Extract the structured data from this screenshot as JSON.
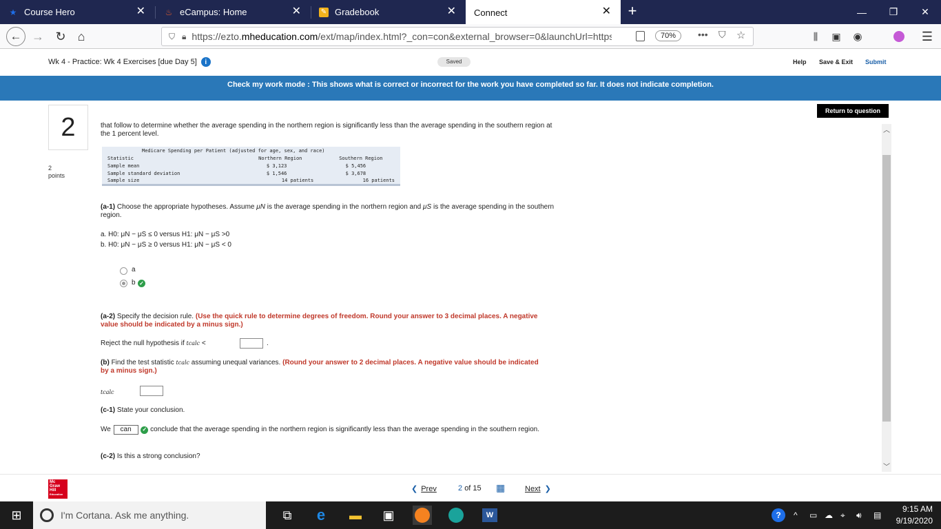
{
  "browser": {
    "tabs": [
      {
        "title": "Course Hero",
        "icon": "star-icon"
      },
      {
        "title": "eCampus: Home",
        "icon": "ecampus-icon"
      },
      {
        "title": "Gradebook",
        "icon": "pencil-icon"
      },
      {
        "title": "Connect",
        "icon": "none"
      }
    ],
    "close_glyph": "✕",
    "new_tab_glyph": "+",
    "url_prefix": "https://ezto.",
    "url_domain": "mheducation.com",
    "url_rest": "/ext/map/index.html?_con=con&external_browser=0&launchUrl=https",
    "zoom": "70%"
  },
  "header": {
    "breadcrumb": "Wk 4 - Practice: Wk 4 Exercises [due Day 5]",
    "saved": "Saved",
    "help": "Help",
    "save_exit": "Save & Exit",
    "submit": "Submit"
  },
  "banner": "Check my work mode : This shows what is correct or incorrect for the work you have completed so far. It does not indicate completion.",
  "return_button": "Return to question",
  "question": {
    "number": "2",
    "points_value": "2",
    "points_label": "points",
    "intro": "that follow to determine whether the average spending in the northern region is significantly less than the average spending in the southern region at the 1 percent level.",
    "table": {
      "title": "Medicare Spending per Patient (adjusted for age, sex, and race)",
      "headers": [
        "Statistic",
        "Northern Region",
        "Southern Region"
      ],
      "rows": [
        [
          "Sample mean",
          "$ 3,123",
          "$ 5,456"
        ],
        [
          "Sample standard deviation",
          "$ 1,546",
          "$ 3,678"
        ],
        [
          "Sample size",
          "14 patients",
          "16 patients"
        ]
      ]
    },
    "a1_label": "(a-1)",
    "a1_text_1": "Choose the appropriate hypotheses. Assume ",
    "a1_mu_n": "μN",
    "a1_text_2": " is the average spending in the northern region and ",
    "a1_mu_s": "μS",
    "a1_text_3": " is the average spending in the southern region.",
    "hyp_a": "a. H0: μN − μS ≤ 0 versus H1: μN − μS >0",
    "hyp_b": "b. H0: μN − μS ≥ 0 versus H1: μN − μS < 0",
    "option_a": "a",
    "option_b": "b",
    "a2_label": "(a-2)",
    "a2_text": "Specify the decision rule.",
    "a2_instruction": "(Use the quick rule to determine degrees of freedom. Round your answer to 3 decimal places. A negative value should be indicated by a minus sign.)",
    "reject_text": "Reject the null hypothesis if",
    "tcalc": "tcalc",
    "lt": "<",
    "period": ".",
    "b_label": "(b)",
    "b_text": "Find the test statistic ",
    "b_text_2": " assuming unequal variances.",
    "b_instruction": "(Round your answer to 2 decimal places. A negative value should be indicated by a minus sign.)",
    "c1_label": "(c-1)",
    "c1_text": "State your conclusion.",
    "we": "We",
    "can_value": "can",
    "c1_rest": "conclude that the average spending in the northern region is significantly less than the average spending in the southern region.",
    "c2_label": "(c-2)",
    "c2_text": "Is this a strong conclusion?"
  },
  "footer": {
    "logo_lines": [
      "Mc",
      "Graw",
      "Hill",
      "Education"
    ],
    "prev": "Prev",
    "page_current": "2",
    "page_of": "of 15",
    "next": "Next"
  },
  "taskbar": {
    "cortana_placeholder": "I'm Cortana. Ask me anything.",
    "time": "9:15 AM",
    "date": "9/19/2020"
  },
  "colors": {
    "tabbar": "#1f2750",
    "banner": "#2a78b8",
    "correct": "#2e9e4a",
    "instruction_red": "#c0392b"
  }
}
